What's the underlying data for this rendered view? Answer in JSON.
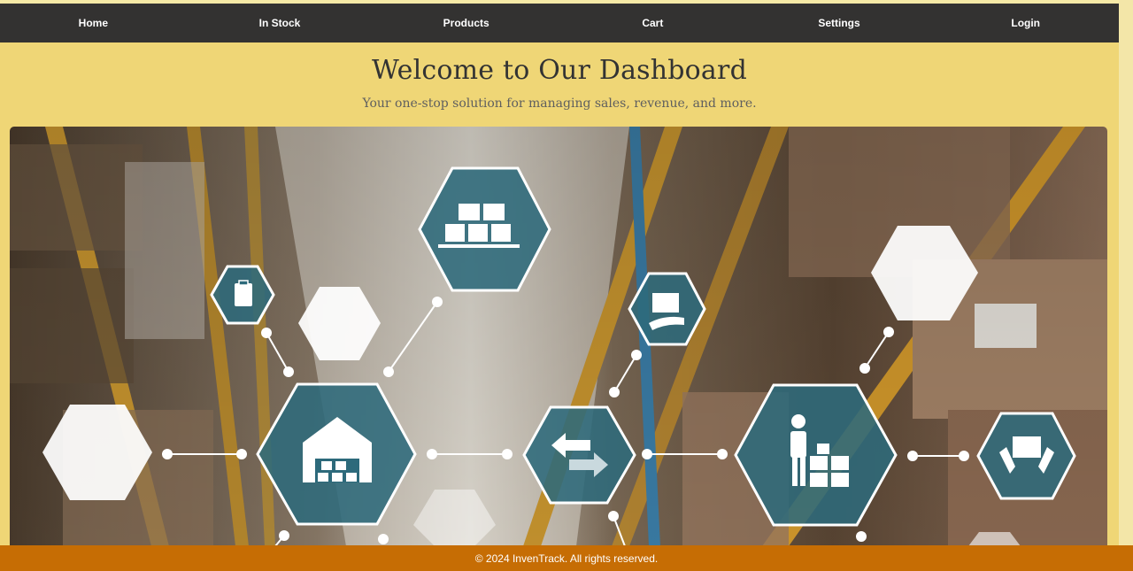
{
  "nav": {
    "home": "Home",
    "in_stock": "In Stock",
    "products": "Products",
    "cart": "Cart",
    "settings": "Settings",
    "login": "Login"
  },
  "hero": {
    "title": "Welcome to Our Dashboard",
    "subtitle": "Your one-stop solution for managing sales, revenue, and more."
  },
  "banner": {
    "icons": [
      "boxes-on-pallet-icon",
      "clipboard-icon",
      "box-in-hand-icon",
      "warehouse-icon",
      "exchange-arrows-icon",
      "worker-with-boxes-icon",
      "box-in-hands-icon"
    ]
  },
  "footer": {
    "text": "© 2024 InvenTrack. All rights reserved."
  },
  "colors": {
    "navbar": "#333231",
    "page_background": "#efd676",
    "footer": "#c66d04",
    "hexagon_fill": "#2d6a7b"
  }
}
